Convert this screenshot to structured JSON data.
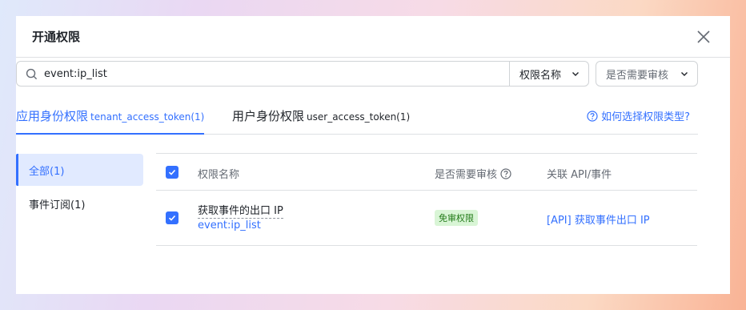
{
  "dialog": {
    "title": "开通权限"
  },
  "search": {
    "value": "event:ip_list",
    "field_select": "权限名称",
    "review_select": "是否需要审核"
  },
  "tabs": [
    {
      "label": "应用身份权限",
      "sub": "tenant_access_token(1)",
      "active": true
    },
    {
      "label": "用户身份权限",
      "sub": "user_access_token(1)",
      "active": false
    }
  ],
  "help_link": "如何选择权限类型?",
  "sidebar": {
    "items": [
      {
        "label": "全部(1)",
        "active": true
      },
      {
        "label": "事件订阅(1)",
        "active": false
      }
    ]
  },
  "table": {
    "headers": {
      "name": "权限名称",
      "review": "是否需要审核",
      "link": "关联 API/事件"
    },
    "rows": [
      {
        "checked": true,
        "title": "获取事件的出口 IP",
        "code": "event:ip_list",
        "review": "免审权限",
        "link": "[API] 获取事件出口 IP"
      }
    ]
  },
  "colors": {
    "accent": "#3370ff",
    "badge_bg": "#d9f5d6",
    "badge_text": "#237b19"
  }
}
